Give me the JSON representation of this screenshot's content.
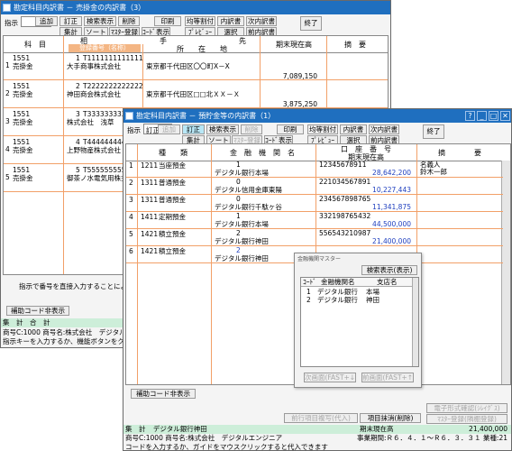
{
  "back_window": {
    "title": "勘定科目内訳書 － 売掛金の内訳書（3）",
    "shiji_label": "指示",
    "buttons_row1": [
      "追加",
      "訂正",
      "検索表示",
      "削除",
      "印刷",
      "均等割付",
      "内訳書",
      "次内訳書",
      "終了"
    ],
    "buttons_row2": [
      "集計",
      "ソート",
      "ﾏｽﾀｰ登録",
      "ｺｰﾄﾞ表示",
      "ﾌﾟﾚﾋﾞｭｰ",
      "選択",
      "前内訳書"
    ],
    "headers": {
      "kamoku": "科　目",
      "aite": "相　　　　　　　　　　手　　　　　　　　　　先",
      "meisho": "登録番号（名称）",
      "shozaichi": "所　　在　　地",
      "balance": "期末現在高",
      "note": "摘　要"
    },
    "rows": [
      {
        "no": "1",
        "code": "1551",
        "kamoku": "売掛金",
        "aite_code": "1",
        "reg": "T1111111111111",
        "name": "大手商事株式会社",
        "address": "東京都千代田区〇〇町X－X",
        "balance": "7,089,150"
      },
      {
        "no": "2",
        "code": "1551",
        "kamoku": "売掛金",
        "aite_code": "2",
        "reg": "T2222222222222",
        "name": "神田商会株式会社",
        "address": "東京都千代田区□□北ＸＸ－Ｘ",
        "balance": "3,875,250"
      },
      {
        "no": "3",
        "code": "1551",
        "kamoku": "売掛金",
        "aite_code": "3",
        "reg": "T3333333333333",
        "name": "株式会社　浅草",
        "address": "",
        "balance": ""
      },
      {
        "no": "4",
        "code": "1551",
        "kamoku": "売掛金",
        "aite_code": "4",
        "reg": "T4444444444444",
        "name": "上野物産株式会社",
        "address": "",
        "balance": ""
      },
      {
        "no": "5",
        "code": "1551",
        "kamoku": "売掛金",
        "aite_code": "5",
        "reg": "T5555555555555",
        "name": "御茶ノ水電気用株式会社",
        "address": "",
        "balance": ""
      }
    ],
    "hint": "指示で番号を直接入力することによ",
    "bottom_button": "補助コード非表示",
    "summary_label": "集　計　合　計",
    "status_line1": "商号C:1000 商号名:株式会社　デジタル",
    "status_line2": "指示キーを入力するか、機能ボタンをク"
  },
  "front_window": {
    "title": "勘定科目内訳書 － 預貯金等の内訳書（1）",
    "shiji_label": "指示",
    "shiji_value": "訂正",
    "buttons_row1": [
      "追加",
      "訂正",
      "検索表示",
      "削除",
      "印刷",
      "均等割付",
      "内訳書",
      "次内訳書",
      "終了"
    ],
    "buttons_row2": [
      "集計",
      "ソート",
      "ﾏｽﾀｰ登録",
      "ｺｰﾄﾞ表示",
      "ﾌﾟﾚﾋﾞｭｰ",
      "選択",
      "前内訳書"
    ],
    "headers": {
      "shurui": "種　　類",
      "kinyu": "金　融　機　関　名",
      "koza": "口　座　番　号",
      "balance": "期末現在高",
      "note": "摘　　　　要"
    },
    "rows": [
      {
        "no": "1",
        "code": "1211",
        "type": "当座預金",
        "bank_code": "1",
        "bank": "デジタル銀行本場",
        "account": "12345678911",
        "balance": "28,642,200",
        "note1": "名義人",
        "note2": "鈴木一郎"
      },
      {
        "no": "2",
        "code": "1311",
        "type": "普通預金",
        "bank_code": "0",
        "bank": "デジタル信用金庫東陽",
        "account": "221034567891",
        "balance": "10,227,443",
        "note1": "",
        "note2": ""
      },
      {
        "no": "3",
        "code": "1311",
        "type": "普通預金",
        "bank_code": "0",
        "bank": "デジタル銀行千駄ヶ谷",
        "account": "234567898765",
        "balance": "11,341,875",
        "note1": "",
        "note2": ""
      },
      {
        "no": "4",
        "code": "1411",
        "type": "定期預金",
        "bank_code": "1",
        "bank": "デジタル銀行本場",
        "account": "332198765432",
        "balance": "44,500,000",
        "note1": "",
        "note2": ""
      },
      {
        "no": "5",
        "code": "1421",
        "type": "積立預金",
        "bank_code": "2",
        "bank": "デジタル銀行神田",
        "account": "556543210987",
        "balance": "21,400,000",
        "note1": "",
        "note2": ""
      },
      {
        "no": "6",
        "code": "1421",
        "type": "積立預金",
        "bank_code": "2",
        "bank": "デジタル銀行神田",
        "account": "",
        "balance": "",
        "note1": "",
        "note2": ""
      }
    ],
    "bottom_button": "補助コード非表示",
    "btn_prev_item": "前行項目複写(代入)",
    "btn_delete_item": "項目抹消(削除)",
    "btn_e_filing": "電子形式確認(ｼﾚｲｸﾞｽ)",
    "btn_master_reg": "ﾏｽﾀｰ登録(隣棚登録)",
    "summary_label": "集　計",
    "summary_bank": "デジタル銀行神田",
    "summary_balance_label": "期末現在高",
    "summary_balance": "21,400,000",
    "status_line1": "商号C:1000 商号名:株式会社　デジタルエンジニア",
    "status_period": "事業期間:Ｒ６．４．１～Ｒ６．３．３１ 業種:21",
    "status_line2": "コードを入力するか、ガイドをマウスクリックすると代入できます"
  },
  "popup": {
    "title": "金融機関マスター",
    "search_button": "検索表示(表示)",
    "col_code": "ｺｰﾄﾞ",
    "col_name": "金融機関名",
    "col_branch": "支店名",
    "items": [
      {
        "code": "1",
        "name": "デジタル銀行",
        "branch": "本場"
      },
      {
        "code": "2",
        "name": "デジタル銀行",
        "branch": "神田"
      }
    ],
    "next_button": "次画面(FAST+↓)",
    "prev_button": "前画面(FAST+↑)"
  }
}
